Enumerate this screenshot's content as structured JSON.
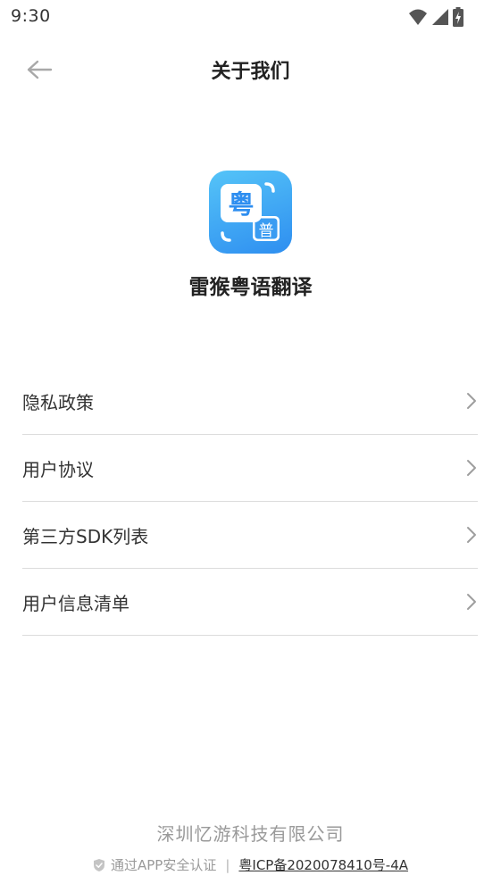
{
  "status_bar": {
    "time": "9:30"
  },
  "nav": {
    "title": "关于我们"
  },
  "app": {
    "name": "雷猴粤语翻译",
    "logo_char_main": "粤",
    "logo_char_sub": "普",
    "logo_colors": [
      "#55c4f8",
      "#2e8ef0"
    ]
  },
  "menu": {
    "items": [
      {
        "label": "隐私政策"
      },
      {
        "label": "用户协议"
      },
      {
        "label": "第三方SDK列表"
      },
      {
        "label": "用户信息清单"
      }
    ]
  },
  "footer": {
    "company": "深圳忆游科技有限公司",
    "security_text": "通过APP安全认证",
    "separator": "|",
    "icp": "粤ICP备2020078410号-4A"
  },
  "colors": {
    "accent": "#2e8ef0",
    "text_primary": "#222222",
    "text_muted": "#9a9a9a",
    "divider": "#dcdcdc"
  }
}
